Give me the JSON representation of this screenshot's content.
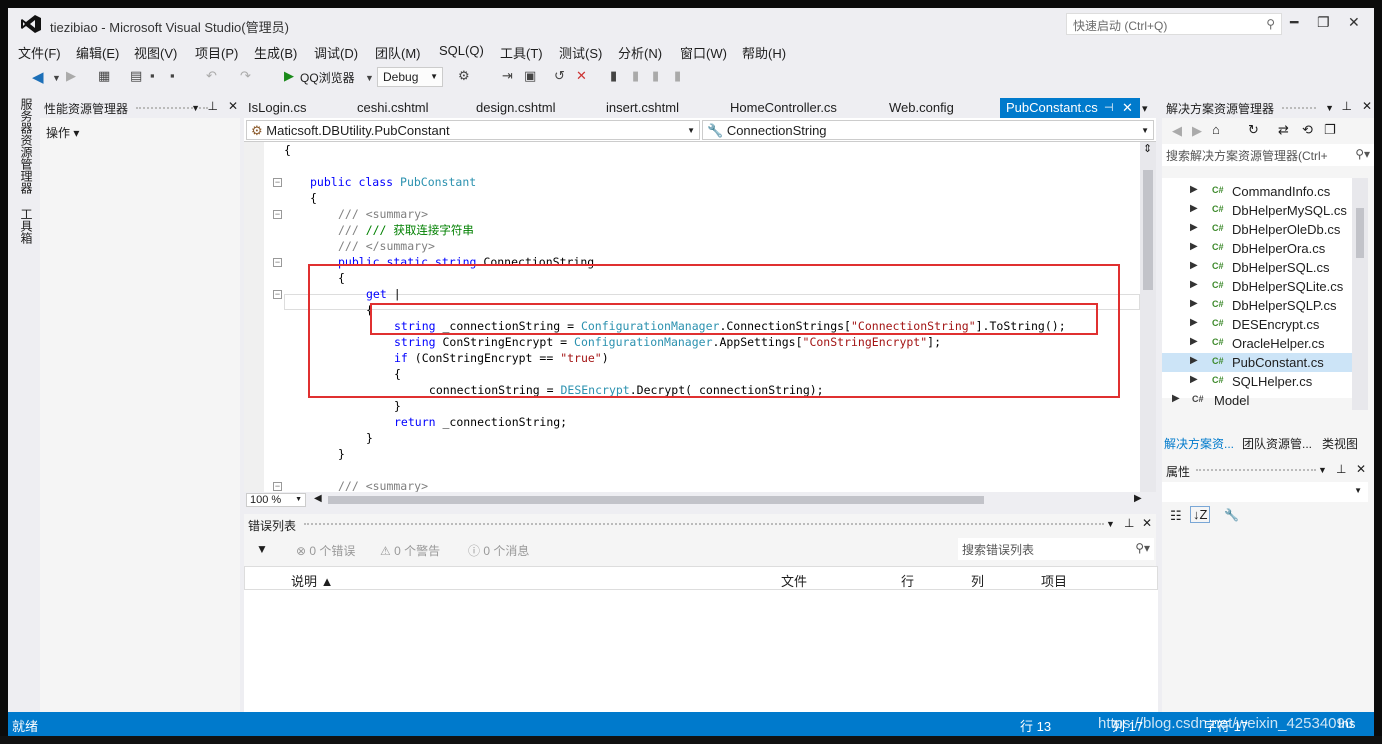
{
  "window": {
    "title": "tiezibiao - Microsoft Visual Studio(管理员)",
    "quick_launch_placeholder": "快速启动 (Ctrl+Q)"
  },
  "menu": [
    "文件(F)",
    "编辑(E)",
    "视图(V)",
    "项目(P)",
    "生成(B)",
    "调试(D)",
    "团队(M)",
    "SQL(Q)",
    "工具(T)",
    "测试(S)",
    "分析(N)",
    "窗口(W)",
    "帮助(H)"
  ],
  "toolbar": {
    "run_label": "QQ浏览器",
    "config": "Debug"
  },
  "left_strip": {
    "server_explorer": "服务器资源管理器",
    "toolbox": "工具箱"
  },
  "perf_panel": {
    "title": "性能资源管理器",
    "actions": "操作"
  },
  "tabs": [
    "IsLogin.cs",
    "ceshi.cshtml",
    "design.cshtml",
    "insert.cshtml",
    "HomeController.cs",
    "Web.config",
    "PubConstant.cs"
  ],
  "navbar": {
    "class_path": "Maticsoft.DBUtility.PubConstant",
    "member": "ConnectionString"
  },
  "code": {
    "l0": "{",
    "l1_kw": "public class ",
    "l1_ty": "PubConstant",
    "l2": "{",
    "l3": "/// <summary>",
    "l4": "/// 获取连接字符串",
    "l5": "/// </summary>",
    "l6_kw": "public static string ",
    "l6_rest": "ConnectionString",
    "l7": "{",
    "l8": "get",
    "l9": "{",
    "l10_kw": "string ",
    "l10_a": "_connectionString = ",
    "l10_ty": "ConfigurationManager",
    "l10_b": ".ConnectionStrings[",
    "l10_st": "\"ConnectionString\"",
    "l10_c": "].ToString();",
    "l11_kw": "string ",
    "l11_a": "ConStringEncrypt = ",
    "l11_ty": "ConfigurationManager",
    "l11_b": ".AppSettings[",
    "l11_st": "\"ConStringEncrypt\"",
    "l11_c": "];",
    "l12_kw": "if ",
    "l12_a": "(ConStringEncrypt == ",
    "l12_st": "\"true\"",
    "l12_c": ")",
    "l13": "{",
    "l14_a": "_connectionString = ",
    "l14_ty": "DESEncrypt",
    "l14_b": ".Decrypt(_connectionString);",
    "l15": "}",
    "l16_kw": "return ",
    "l16_a": "_connectionString;",
    "l17": "}",
    "l18": "}",
    "l19": "/// <summary>"
  },
  "zoom": "100 %",
  "error_list": {
    "title": "错误列表",
    "errors": "0 个错误",
    "warnings": "0 个警告",
    "messages": "0 个消息",
    "search_placeholder": "搜索错误列表",
    "columns": [
      "说明",
      "文件",
      "行",
      "列",
      "项目"
    ]
  },
  "solution_explorer": {
    "title": "解决方案资源管理器",
    "search_placeholder": "搜索解决方案资源管理器(Ctrl+",
    "items": [
      "CommandInfo.cs",
      "DbHelperMySQL.cs",
      "DbHelperOleDb.cs",
      "DbHelperOra.cs",
      "DbHelperSQL.cs",
      "DbHelperSQLite.cs",
      "DbHelperSQLP.cs",
      "DESEncrypt.cs",
      "OracleHelper.cs",
      "PubConstant.cs",
      "SQLHelper.cs"
    ],
    "project": "Model",
    "bottom_tabs": [
      "解决方案资...",
      "团队资源管...",
      "类视图"
    ]
  },
  "properties": {
    "title": "属性"
  },
  "status": {
    "ready": "就绪",
    "line": "行 13",
    "col": "列 17",
    "ch": "字符 17",
    "ins": "Ins",
    "watermark": "https://blog.csdn.net/weixin_42534090"
  },
  "colors": {
    "accent": "#007acc",
    "highlight": "#e03030"
  }
}
